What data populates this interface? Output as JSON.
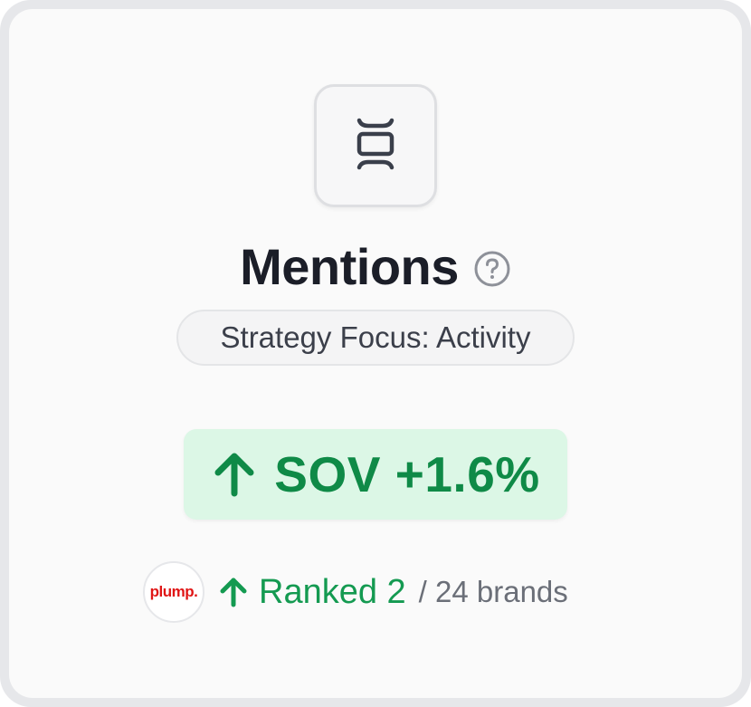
{
  "card": {
    "title": "Mentions",
    "icon": "split-vertical-icon",
    "help_icon": "question-circle-icon",
    "strategy_label": "Strategy Focus: Activity",
    "sov": {
      "direction": "up",
      "label": "SOV +1.6%",
      "color": "#0f8a47",
      "background": "#dcf7e6"
    },
    "ranking": {
      "brand_logo_text": "plump.",
      "direction": "up",
      "rank_label": "Ranked 2",
      "total_label": "/ 24 brands"
    }
  }
}
